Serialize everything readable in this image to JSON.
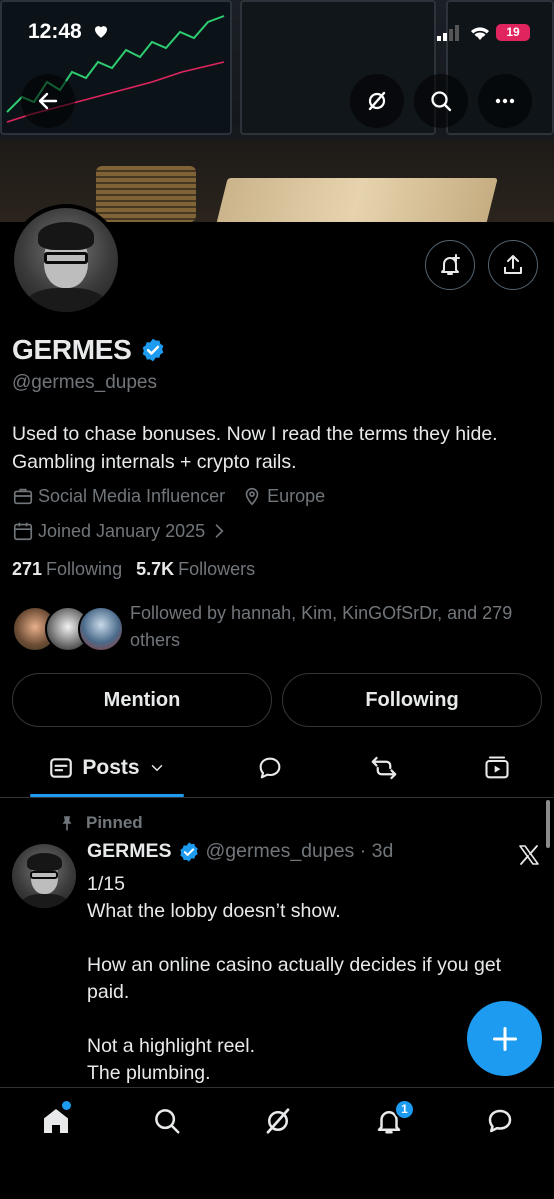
{
  "status_bar": {
    "time": "12:48",
    "battery": "19"
  },
  "profile": {
    "display_name": "GERMES",
    "handle": "@germes_dupes",
    "bio": "Used to chase bonuses. Now I read the terms they hide. Gambling internals + crypto rails.",
    "category": "Social Media Influencer",
    "location": "Europe",
    "joined": "Joined January 2025",
    "following_count": "271",
    "following_label": "Following",
    "followers_count": "5.7K",
    "followers_label": "Followers",
    "followed_by": "Followed by hannah, Kim, KinGOfSrDr, and 279 others"
  },
  "actions": {
    "mention_label": "Mention",
    "following_label": "Following"
  },
  "tabs": {
    "posts_label": "Posts"
  },
  "pinned_post": {
    "pinned_label": "Pinned",
    "author": "GERMES",
    "handle_time": "@germes_dupes · 3d",
    "text": "1/15\nWhat the lobby doesn’t show.\n\nHow an online casino actually decides if you get paid.\n\nNot a highlight reel.\nThe plumbing."
  },
  "bottom_nav": {
    "notification_count": "1"
  },
  "colors": {
    "accent": "#1d9bf0",
    "background": "#000000",
    "secondary_text": "#71767b",
    "primary_text": "#e7e9ea"
  },
  "icons": [
    "back-arrow-icon",
    "grok-icon",
    "search-icon",
    "more-icon",
    "notify-bell-icon",
    "share-icon",
    "verified-badge-icon",
    "briefcase-icon",
    "location-pin-icon",
    "calendar-icon",
    "chevron-right-icon",
    "posts-icon",
    "chevron-down-icon",
    "replies-icon",
    "reposts-icon",
    "media-icon",
    "pin-icon",
    "x-logo-icon",
    "compose-plus-icon",
    "home-icon",
    "search-nav-icon",
    "grok-nav-icon",
    "notifications-icon",
    "messages-icon"
  ]
}
